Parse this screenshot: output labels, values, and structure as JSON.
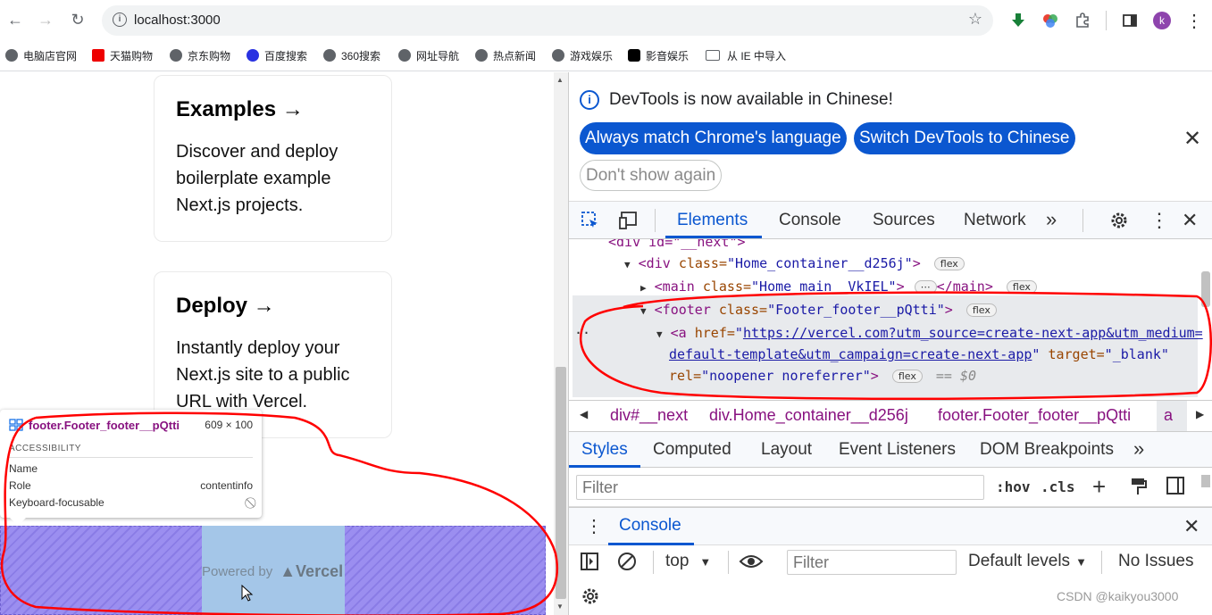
{
  "browser": {
    "url": "localhost:3000",
    "profile_initial": "k",
    "bookmarks": [
      "电脑店官网",
      "天猫购物",
      "京东购物",
      "百度搜索",
      "360搜索",
      "网址导航",
      "热点新闻",
      "游戏娱乐",
      "影音娱乐",
      "从 IE 中导入"
    ]
  },
  "page": {
    "cards": [
      {
        "title": "Examples →",
        "desc": "Discover and deploy boilerplate example Next.js projects."
      },
      {
        "title": "Deploy →",
        "desc": "Instantly deploy your Next.js site to a public URL with Vercel."
      }
    ],
    "footer": {
      "powered_by": "Powered by",
      "logo_text": "Vercel"
    },
    "tooltip": {
      "selector": "footer.Footer_footer__pQtti",
      "size": "609 × 100",
      "section": "ACCESSIBILITY",
      "rows": [
        {
          "label": "Name",
          "value": ""
        },
        {
          "label": "Role",
          "value": "contentinfo"
        },
        {
          "label": "Keyboard-focusable",
          "value": "⃠"
        }
      ]
    }
  },
  "devtools": {
    "infobar": {
      "message": "DevTools is now available in Chinese!",
      "btn_match": "Always match Chrome's language",
      "btn_switch": "Switch DevTools to Chinese",
      "btn_dont_show": "Don't show again"
    },
    "tabs": [
      "Elements",
      "Console",
      "Sources",
      "Network"
    ],
    "active_tab": "Elements",
    "dom": {
      "l0": "<div id=\"__next\">",
      "l1_tag": "<div ",
      "l1_attr": "class=",
      "l1_val": "\"Home_container__d256j\"",
      "l1_close": ">",
      "l2_tag": "<main ",
      "l2_attr": "class=",
      "l2_val": "\"Home_main__VkIEL\"",
      "l2_close": ">",
      "l2_end": "</main>",
      "l3_tag": "<footer ",
      "l3_attr": "class=",
      "l3_val": "\"Footer_footer__pQtti\"",
      "l3_close": ">",
      "l4_tag": "<a ",
      "l4_attr": "href=",
      "l4_link1": "https://vercel.com?utm_source=create-next-app&utm_medium=",
      "l4_link2": "default-template&utm_campaign=create-next-app",
      "l4_target_attr": " target=",
      "l4_target_val": "\"_blank\"",
      "l4_rel_attr": "rel=",
      "l4_rel_val": "\"noopener noreferrer\"",
      "l4_close": ">",
      "eq": "== $0",
      "badge": "flex",
      "ellipsis": "⋯"
    },
    "breadcrumbs": [
      "div#__next",
      "div.Home_container__d256j",
      "footer.Footer_footer__pQtti",
      "a"
    ],
    "style_tabs": [
      "Styles",
      "Computed",
      "Layout",
      "Event Listeners",
      "DOM Breakpoints"
    ],
    "styles_filter_placeholder": "Filter",
    "hov": ":hov",
    "cls": ".cls",
    "console": {
      "title": "Console",
      "context": "top",
      "filter_placeholder": "Filter",
      "levels": "Default levels",
      "issues": "No Issues"
    }
  },
  "watermark": "CSDN @kaikyou3000",
  "colors": {
    "accent": "#0b57d0",
    "annotation": "#ff0000",
    "footer_overlay": "#9b8ef0"
  }
}
